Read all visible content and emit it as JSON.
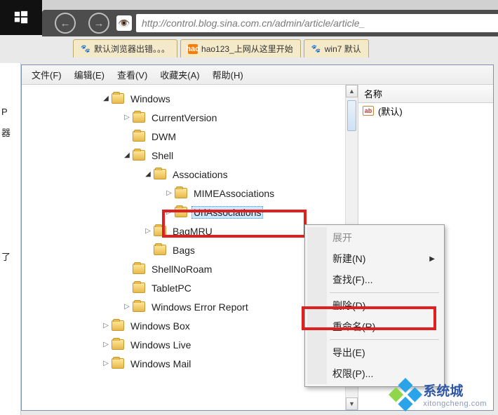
{
  "browser": {
    "url": "http://control.blog.sina.com.cn/admin/article/article_",
    "tabs": [
      {
        "label": "默认浏览器出错。。。",
        "fav": "paw"
      },
      {
        "label": "hao123_上网从这里开始",
        "fav": "hao"
      },
      {
        "label": "win7 默认",
        "fav": "paw"
      }
    ]
  },
  "left_text": {
    "a": "P",
    "b": "器",
    "c": "了"
  },
  "menubar": {
    "file": "文件(F)",
    "edit": "编辑(E)",
    "view": "查看(V)",
    "favorites": "收藏夹(A)",
    "help": "帮助(H)"
  },
  "list": {
    "header_name": "名称",
    "default_value": "(默认)"
  },
  "tree": [
    {
      "indent": 0,
      "exp": "open",
      "label": "Windows"
    },
    {
      "indent": 1,
      "exp": "closed",
      "label": "CurrentVersion"
    },
    {
      "indent": 1,
      "exp": "none",
      "label": "DWM"
    },
    {
      "indent": 1,
      "exp": "open",
      "label": "Shell"
    },
    {
      "indent": 2,
      "exp": "open",
      "label": "Associations"
    },
    {
      "indent": 3,
      "exp": "closed",
      "label": "MIMEAssociations"
    },
    {
      "indent": 3,
      "exp": "closed",
      "label": "UrlAssociations",
      "selected": true
    },
    {
      "indent": 2,
      "exp": "closed",
      "label": "BagMRU"
    },
    {
      "indent": 2,
      "exp": "none",
      "label": "Bags"
    },
    {
      "indent": 1,
      "exp": "none",
      "label": "ShellNoRoam"
    },
    {
      "indent": 1,
      "exp": "none",
      "label": "TabletPC"
    },
    {
      "indent": 1,
      "exp": "closed",
      "label": "Windows Error Report"
    },
    {
      "indent": 0,
      "exp": "closed",
      "label": "Windows Box"
    },
    {
      "indent": 0,
      "exp": "closed",
      "label": "Windows Live"
    },
    {
      "indent": 0,
      "exp": "closed",
      "label": "Windows Mail"
    }
  ],
  "context_menu": {
    "expand": "展开",
    "new": "新建(N)",
    "find": "查找(F)...",
    "delete": "删除(D)",
    "rename": "重命名(R)",
    "export": "导出(E)",
    "permissions": "权限(P)..."
  },
  "watermark": {
    "brand": "系统城",
    "url": "xitongcheng.com"
  }
}
